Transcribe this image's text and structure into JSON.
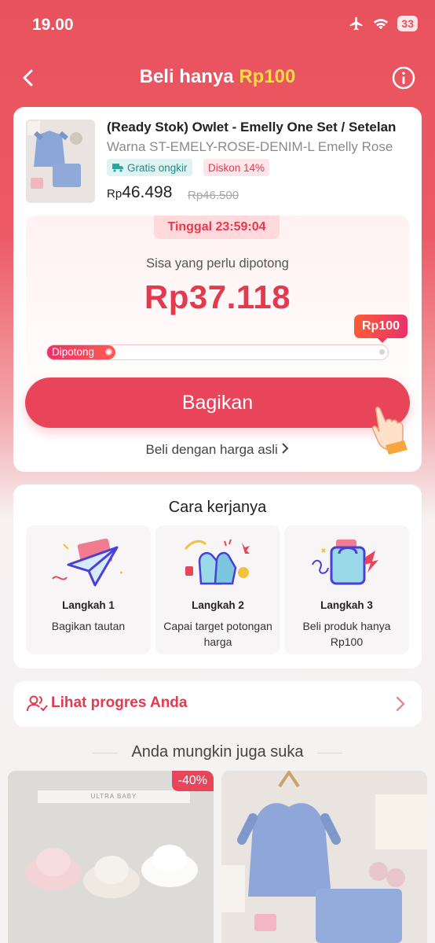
{
  "status_bar": {
    "time": "19.00",
    "battery": "33"
  },
  "header": {
    "title_prefix": "Beli hanya",
    "title_highlight": "Rp100"
  },
  "product": {
    "title": "(Ready Stok) Owlet - Emelly One Set / Setelan",
    "variant": "Warna ST-EMELY-ROSE-DENIM-L Emelly Rose",
    "tag_shipping": "Gratis ongkir",
    "tag_discount": "Diskon 14%",
    "price_currency": "Rp",
    "price_value": "46.498",
    "price_original": "Rp46.500"
  },
  "bargain": {
    "timer": "Tinggal 23:59:04",
    "remain_label": "Sisa yang perlu dipotong",
    "remain_amount": "Rp37.118",
    "target_price": "Rp100",
    "progress_label": "Dipotong",
    "progress_fraction": 0.2,
    "share_button": "Bagikan",
    "buy_normal": "Beli dengan harga asli"
  },
  "how_it_works": {
    "title": "Cara kerjanya",
    "steps": [
      {
        "num": "Langkah 1",
        "desc": "Bagikan tautan"
      },
      {
        "num": "Langkah 2",
        "desc": "Capai target potongan harga"
      },
      {
        "num": "Langkah 3",
        "desc": "Beli produk hanya Rp100"
      }
    ]
  },
  "progress_link": {
    "label": "Lihat progres Anda"
  },
  "suggestions": {
    "title": "Anda mungkin juga suka",
    "items": [
      {
        "discount": "-40%",
        "brand": "ULTRA BABY"
      },
      {
        "discount": ""
      }
    ]
  },
  "colors": {
    "accent": "#e8455a",
    "highlight": "#ffd84a",
    "shipping_tag": "#1f8a84"
  }
}
